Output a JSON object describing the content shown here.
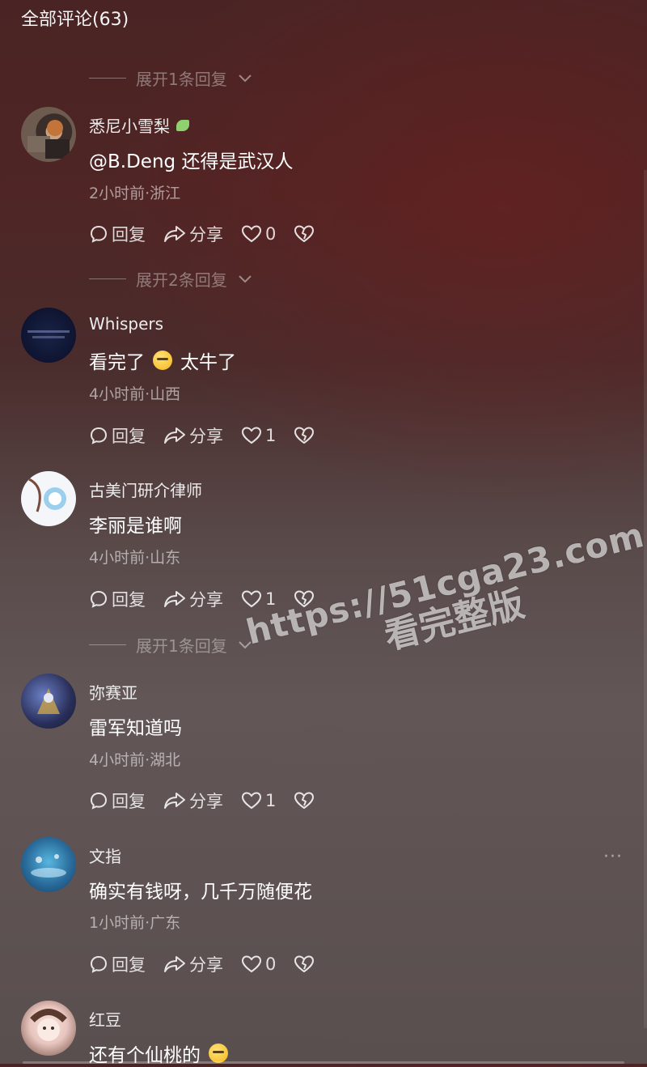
{
  "header": {
    "title": "全部评论(63)"
  },
  "expanders": [
    {
      "label": "展开1条回复"
    },
    {
      "label": "展开2条回复"
    },
    {
      "label": "展开1条回复"
    }
  ],
  "actions": {
    "reply_label": "回复",
    "share_label": "分享"
  },
  "comments": [
    {
      "username": "悉尼小雪梨",
      "text": "@B.Deng  还得是武汉人",
      "meta": "2小时前·浙江",
      "likes": "0",
      "badge": "leaf-icon"
    },
    {
      "username": "Whispers",
      "text_a": "看完了",
      "text_b": "太牛了",
      "meta": "4小时前·山西",
      "likes": "1"
    },
    {
      "username": "古美门研介律师",
      "text": "李丽是谁啊",
      "meta": "4小时前·山东",
      "likes": "1"
    },
    {
      "username": "弥赛亚",
      "text": "雷军知道吗",
      "meta": "4小时前·湖北",
      "likes": "1"
    },
    {
      "username": "文指",
      "text": "确实有钱呀，几千万随便花",
      "meta": "1小时前·广东",
      "likes": "0"
    },
    {
      "username": "红豆",
      "text": "还有个仙桃的"
    }
  ],
  "more_menu": "···",
  "watermark": {
    "line1": "https://51cga23.com",
    "line2": "看完整版"
  }
}
